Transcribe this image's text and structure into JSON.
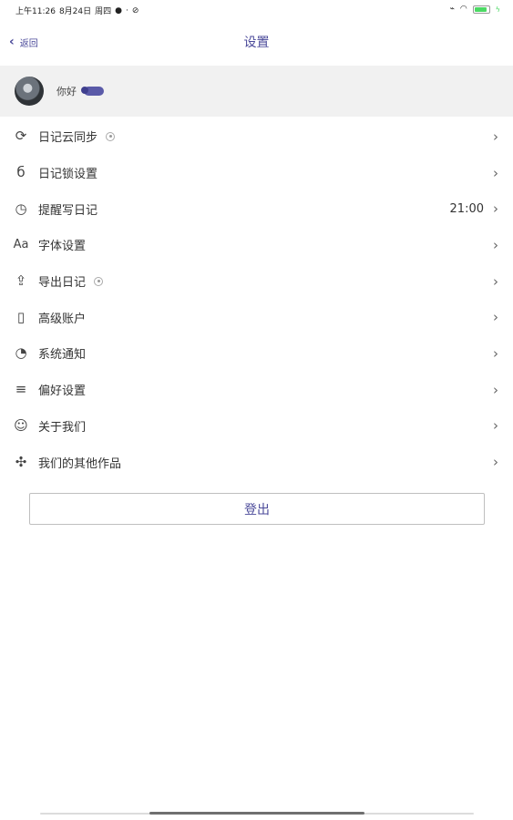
{
  "status_bar": {
    "time": "上午11:26",
    "date": "8月24日",
    "weekday": "周四",
    "icons": [
      "notification-icon",
      "signal-icon",
      "battery-icon"
    ]
  },
  "nav": {
    "back_label": "返回",
    "title": "设置"
  },
  "profile": {
    "name": "你好"
  },
  "menu": {
    "items": [
      {
        "label": "日记云同步",
        "icon": "cloud-sync-icon",
        "value": ""
      },
      {
        "label": "日记锁设置",
        "icon": "lock-icon",
        "value": ""
      },
      {
        "label": "提醒写日记",
        "icon": "clock-icon",
        "value": "21:00"
      },
      {
        "label": "字体设置",
        "icon": "font-icon",
        "value": ""
      },
      {
        "label": "导出日记",
        "icon": "export-icon",
        "value": ""
      },
      {
        "label": "高级账户",
        "icon": "vip-icon",
        "value": ""
      },
      {
        "label": "系统通知",
        "icon": "bell-icon",
        "value": ""
      },
      {
        "label": "偏好设置",
        "icon": "preferences-icon",
        "value": ""
      },
      {
        "label": "关于我们",
        "icon": "about-icon",
        "value": ""
      },
      {
        "label": "我们的其他作品",
        "icon": "apps-icon",
        "value": ""
      }
    ]
  },
  "logout": {
    "label": "登出"
  },
  "colors": {
    "accent": "#4b4a9a",
    "profile_bg": "#f1f1f1"
  }
}
